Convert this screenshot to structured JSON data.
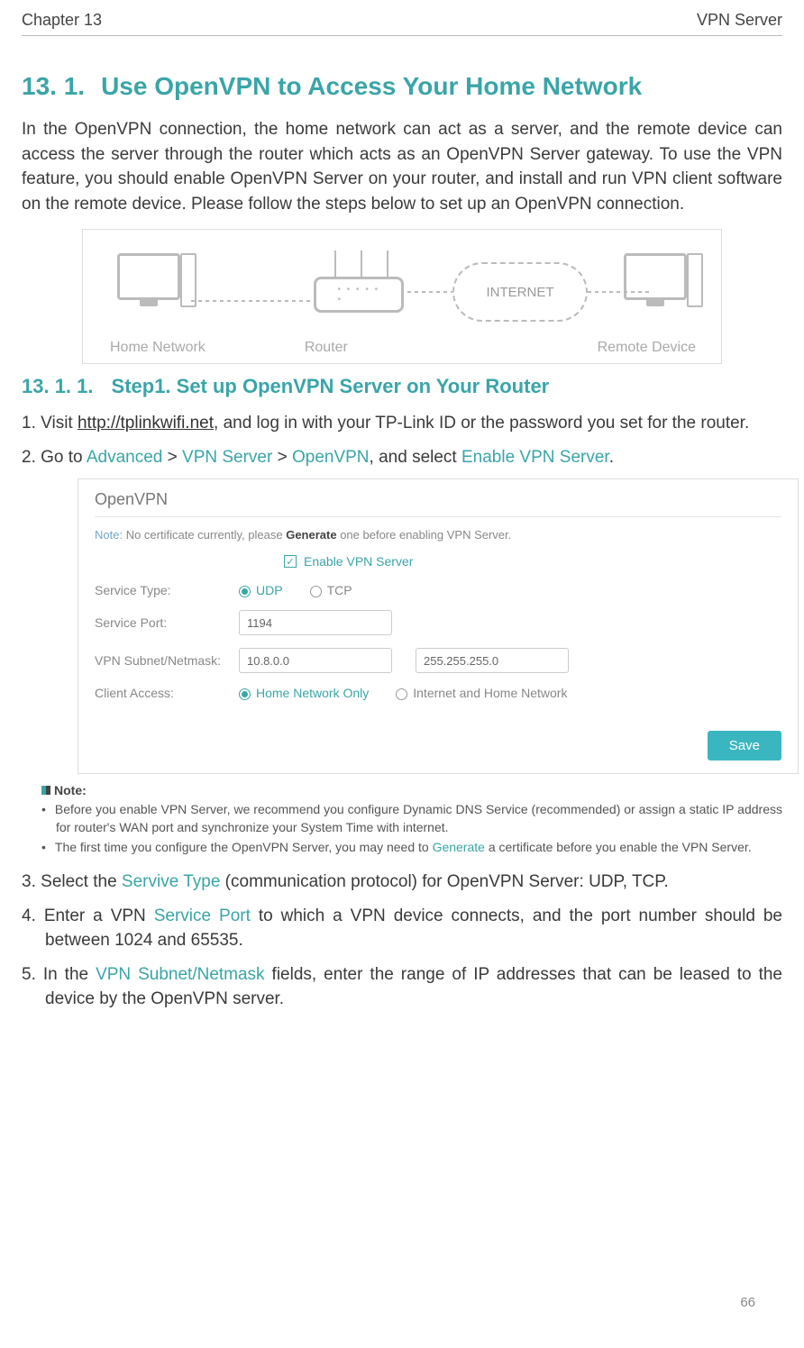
{
  "header": {
    "chapter": "Chapter 13",
    "title": "VPN Server"
  },
  "section": {
    "number": "13. 1.",
    "title": "Use OpenVPN to Access Your Home Network",
    "intro": "In the OpenVPN connection, the home network can act as a server, and the remote device can access the server through the router which acts as an OpenVPN Server gateway. To use the VPN feature, you should enable OpenVPN Server on your router, and install and run VPN client software on the remote device. Please follow the steps below to set up an OpenVPN connection."
  },
  "diagram1": {
    "home": "Home Network",
    "router": "Router",
    "internet": "INTERNET",
    "remote": "Remote Device"
  },
  "subsection": {
    "number": "13. 1. 1.",
    "title": "Step1. Set up OpenVPN Server on Your Router"
  },
  "steps": {
    "s1_a": "Visit ",
    "s1_link": "http://tplinkwifi.net",
    "s1_b": ", and log in with your TP-Link ID or the password you set for the router.",
    "s2_a": "Go to ",
    "s2_adv": "Advanced",
    "s2_gt1": " > ",
    "s2_vpn": "VPN Server",
    "s2_gt2": " > ",
    "s2_open": "OpenVPN",
    "s2_b": ", and select ",
    "s2_enable": "Enable VPN Server",
    "s2_c": ".",
    "s3_a": "Select the ",
    "s3_serv": "Servive Type",
    "s3_b": " (communication protocol) for OpenVPN Server: UDP, TCP.",
    "s4_a": "Enter a VPN ",
    "s4_port": "Service Port",
    "s4_b": " to which a VPN device connects, and the port number should be between 1024 and 65535.",
    "s5_a": "In the ",
    "s5_sub": "VPN Subnet/Netmask",
    "s5_b": " fields, enter the range of IP addresses that can be leased to the device by the OpenVPN server."
  },
  "screenshot": {
    "title": "OpenVPN",
    "note_prefix": "Note:",
    "note_text": "  No certificate currently, please ",
    "note_gen": "Generate",
    "note_suffix": " one before enabling VPN Server.",
    "enable_label": "Enable VPN Server",
    "row_service_type": "Service Type:",
    "udp": "UDP",
    "tcp": "TCP",
    "row_service_port": "Service Port:",
    "port_value": "1194",
    "row_subnet": "VPN Subnet/Netmask:",
    "subnet_value": "10.8.0.0",
    "netmask_value": "255.255.255.0",
    "row_client": "Client Access:",
    "client_home": "Home Network Only",
    "client_inet": "Internet and Home Network",
    "save": "Save"
  },
  "note": {
    "label": "Note:",
    "b1": "Before you enable VPN Server, we recommend you configure Dynamic DNS Service (recommended) or assign a static IP address for router's WAN port and synchronize your System Time with internet.",
    "b2_a": "The first time you configure the OpenVPN Server, you may need to ",
    "b2_gen": "Generate",
    "b2_b": " a certificate before you enable the VPN Server."
  },
  "page_number": "66"
}
